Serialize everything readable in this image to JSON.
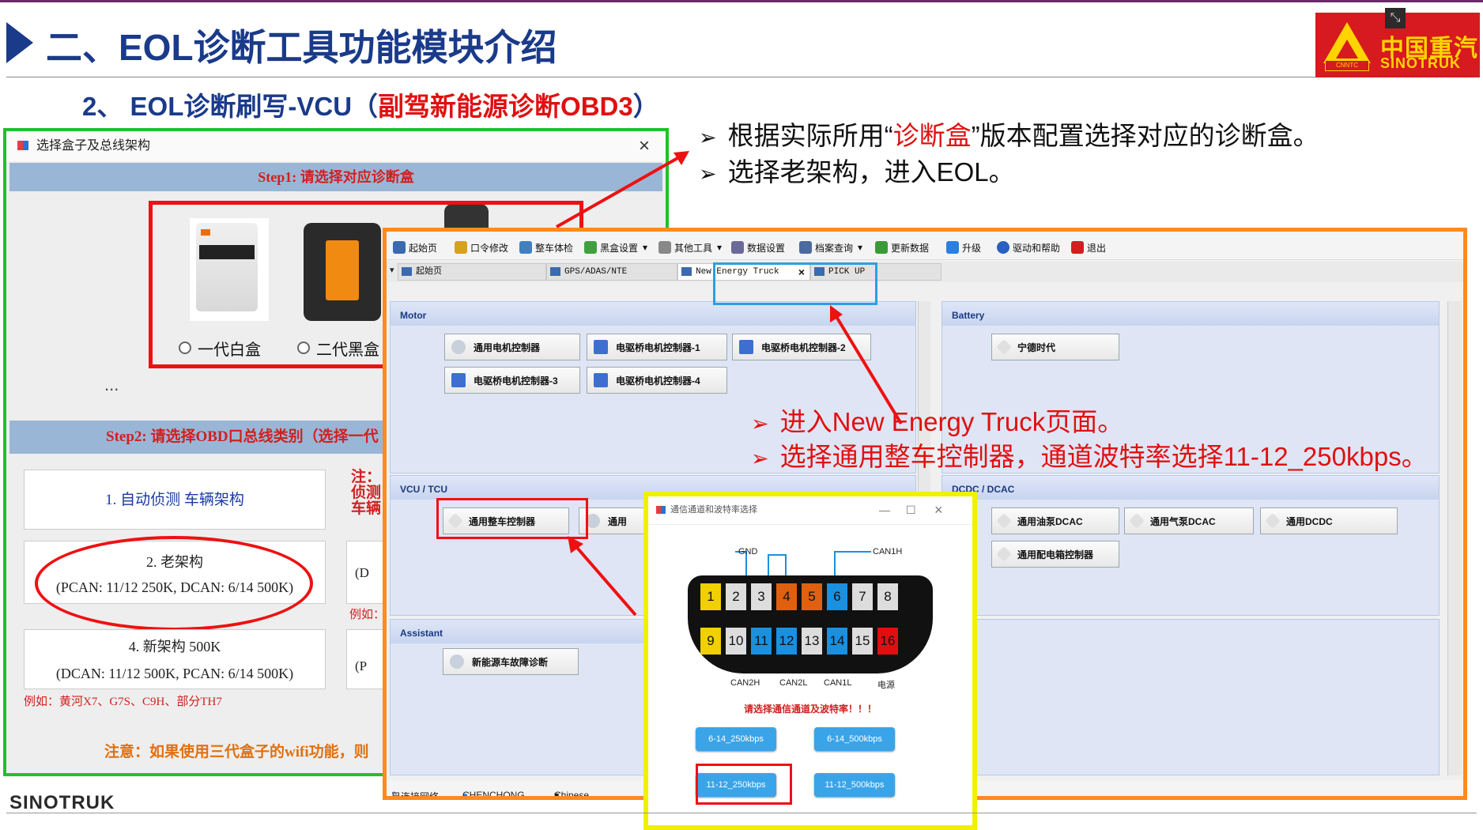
{
  "header": {
    "title": "二、EOL诊断工具功能模块介绍",
    "subtitle_prefix": "2、 EOL诊断刷写-VCU（",
    "subtitle_red": "副驾新能源诊断OBD3",
    "subtitle_suffix": "）",
    "logo_cn": "中国重汽",
    "logo_en": "SINOTRUK",
    "logo_tag": "CNNTC",
    "shrink_icon": "⤡"
  },
  "bullets": {
    "marker": "➢",
    "b1_pre": "根据实际所用“",
    "b1_red": "诊断盒",
    "b1_post": "”版本配置选择对应的诊断盒。",
    "b2": "选择老架构，进入EOL。"
  },
  "dialog1": {
    "title": "选择盒子及总线架构",
    "close": "×",
    "step1": "Step1: 请选择对应诊断盒",
    "box1": "一代白盒",
    "box2": "二代黑盒",
    "ellipsis": "...",
    "step2": "Step2: 请选择OBD口总线类别（选择一代",
    "opt1": "1.  自动侦测 车辆架构",
    "opt2_l1": "2.  老架构",
    "opt2_l2": "(PCAN: 11/12 250K, DCAN: 6/14 500K)",
    "opt3_l1": "4.  新架构 500K",
    "opt3_l2": "(DCAN: 11/12 500K, PCAN: 6/14 500K)",
    "example1": "例如：黄河X7、G7S、C9H、部分TH7",
    "example2": "例如：",
    "note_l1": "注：",
    "note_l2": "侦测",
    "note_l3": "车辆",
    "side2": "(D",
    "side3": "(P",
    "note_bottom": "注意：如果使用三代盒子的wifi功能，则"
  },
  "app": {
    "menu": [
      {
        "label": "起始页",
        "icon": "home-icon",
        "color": "#3a6ab0"
      },
      {
        "label": "口令修改",
        "icon": "key-icon",
        "color": "#d8a020"
      },
      {
        "label": "整车体检",
        "icon": "truck-icon",
        "color": "#4080c0"
      },
      {
        "label": "黑盒设置",
        "icon": "blackbox-icon",
        "color": "#40a040"
      },
      {
        "label": "其他工具",
        "icon": "wrench-icon",
        "color": "#888888"
      },
      {
        "label": "数据设置",
        "icon": "data-icon",
        "color": "#6a6a9a"
      },
      {
        "label": "档案查询",
        "icon": "magnifier-icon",
        "color": "#4a6aa0"
      },
      {
        "label": "更新数据",
        "icon": "update-icon",
        "color": "#3a9a3a"
      },
      {
        "label": "升级",
        "icon": "upgrade-icon",
        "color": "#2a80e0"
      },
      {
        "label": "驱动和帮助",
        "icon": "help-icon",
        "color": "#2a60c0"
      },
      {
        "label": "退出",
        "icon": "exit-icon",
        "color": "#d02020"
      }
    ],
    "tabs": {
      "t1": "起始页",
      "t2": "GPS/ADAS/NTE",
      "t3": "New Energy Truck",
      "t4": "PICK UP",
      "close": "×",
      "dropdown": "▾"
    },
    "motor": {
      "title": "Motor",
      "b1": "通用电机控制器",
      "b2": "电驱桥电机控制器-1",
      "b3": "电驱桥电机控制器-2",
      "b4": "电驱桥电机控制器-3",
      "b5": "电驱桥电机控制器-4"
    },
    "battery": {
      "title": "Battery",
      "b1": "宁德时代"
    },
    "vcu": {
      "title": "VCU / TCU",
      "b1": "通用整车控制器",
      "b2": "通用"
    },
    "dcdc": {
      "title": "DCDC / DCAC",
      "b1": "通用油泵DCAC",
      "b2": "通用气泵DCAC",
      "b3": "通用DCDC",
      "b4": "通用配电箱控制器"
    },
    "assistant": {
      "title": "Assistant",
      "b1": "新能源车故障诊断"
    },
    "right_partial": "制器",
    "status": {
      "s1": "已连接网络",
      "s2": "CHENCHONG",
      "s3": "Chinese"
    }
  },
  "callouts": {
    "c1": "进入New Energy Truck页面。",
    "c2": "选择通用整车控制器，通道波特率选择11-12_250kbps。",
    "marker": "➢"
  },
  "obd": {
    "title": "通信通道和波特率选择",
    "min": "—",
    "max": "☐",
    "close": "×",
    "pins_top": [
      "1",
      "2",
      "3",
      "4",
      "5",
      "6",
      "7",
      "8"
    ],
    "pins_bottom": [
      "9",
      "10",
      "11",
      "12",
      "13",
      "14",
      "15",
      "16"
    ],
    "lbl_gnd": "GND",
    "lbl_can1h": "CAN1H",
    "lbl_can2h": "CAN2H",
    "lbl_can2l": "CAN2L",
    "lbl_can1l": "CAN1L",
    "lbl_power": "电源",
    "warn": "请选择通信通道及波特率！！！",
    "b1": "6-14_250kbps",
    "b2": "6-14_500kbps",
    "b3": "11-12_250kbps",
    "b4": "11-12_500kbps"
  },
  "footer": {
    "brand": "SINOTRUK"
  }
}
